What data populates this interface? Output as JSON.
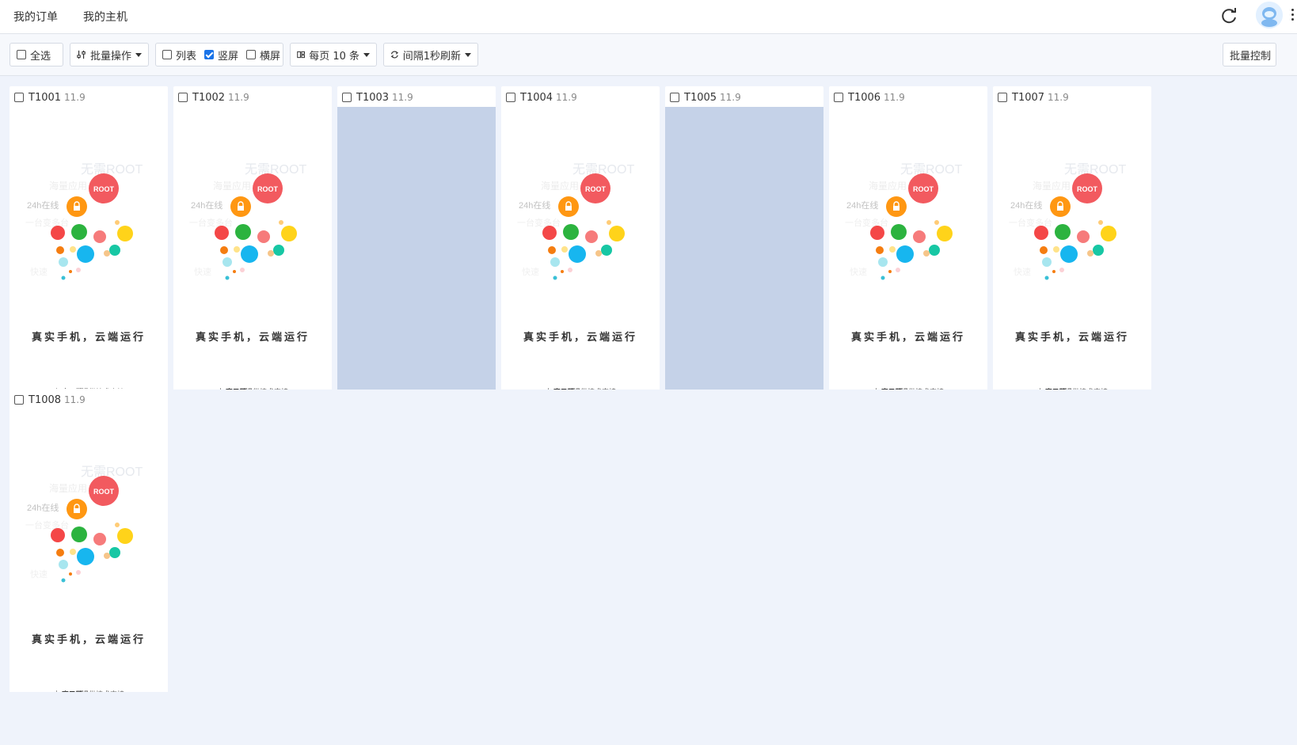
{
  "nav": {
    "items": [
      "我的订单",
      "我的主机"
    ]
  },
  "toolbar": {
    "select_all": "全选",
    "batch_ops": "批量操作",
    "view_list": "列表",
    "view_portrait": "竖屏",
    "view_landscape": "横屏",
    "page_size": "每页 10 条",
    "refresh_interval": "间隔1秒刷新",
    "batch_control": "批量控制",
    "portrait_checked": true
  },
  "devices": [
    {
      "id": "T1001",
      "version": "11.9",
      "state": "splash"
    },
    {
      "id": "T1002",
      "version": "11.9",
      "state": "splash"
    },
    {
      "id": "T1003",
      "version": "11.9",
      "state": "blank"
    },
    {
      "id": "T1004",
      "version": "11.9",
      "state": "splash"
    },
    {
      "id": "T1005",
      "version": "11.9",
      "state": "blank"
    },
    {
      "id": "T1006",
      "version": "11.9",
      "state": "splash"
    },
    {
      "id": "T1007",
      "version": "11.9",
      "state": "splash"
    },
    {
      "id": "T1008",
      "version": "11.9",
      "state": "splash"
    }
  ],
  "splash": {
    "headline": "无需ROOT",
    "root_badge": "ROOT",
    "online": "24h在线",
    "slogan": "真实手机，云端运行",
    "footer_prefix": "由",
    "footer_brand": "魔云腾",
    "footer_suffix": "提供技术支持"
  },
  "colors": {
    "accent": "#1a73e8",
    "blank_screen": "#c5d2e8",
    "page_bg": "#eff3fb"
  }
}
